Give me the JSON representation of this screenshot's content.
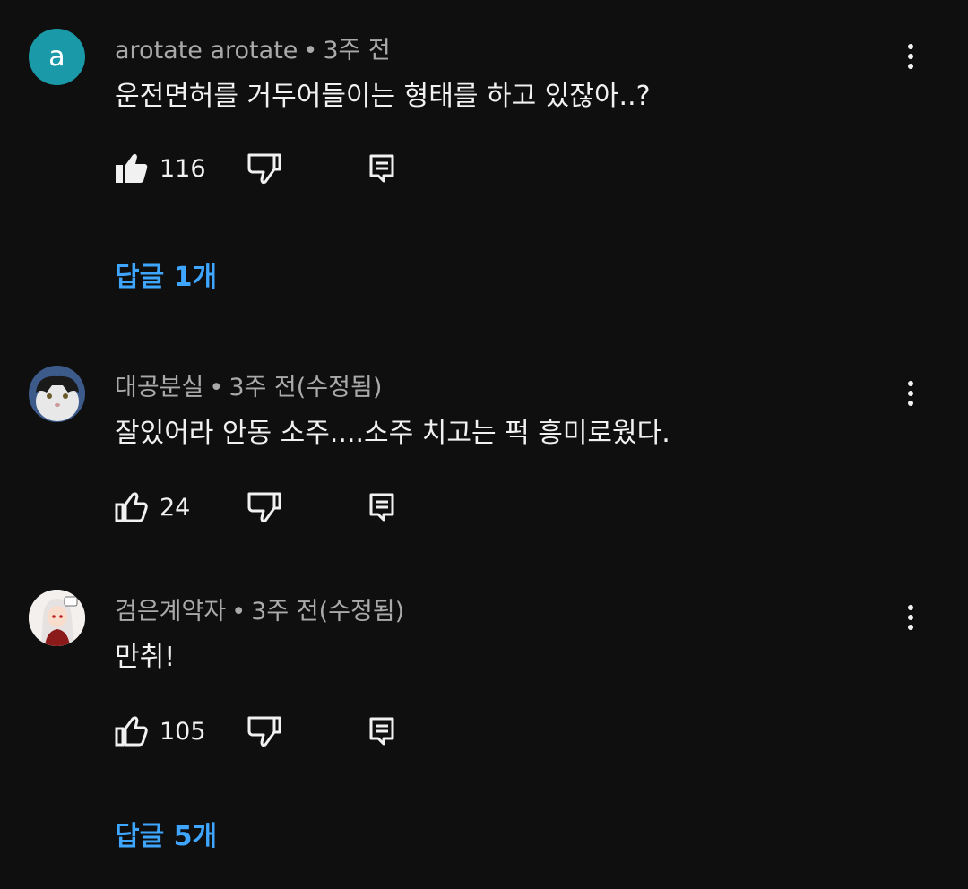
{
  "comments": [
    {
      "author": "arotate arotate",
      "time": "3주 전",
      "edited": "",
      "avatar_letter": "a",
      "avatar_color": "#1a9aa8",
      "text": "운전면허를 거두어들이는 형태를 하고 있잖아..?",
      "likes": "116",
      "liked": true,
      "replies_label": "답글 1개"
    },
    {
      "author": "대공분실",
      "time": "3주 전",
      "edited": "(수정됨)",
      "avatar_icon": "cat-avatar-icon",
      "text": "잘있어라 안동 소주....소주 치고는 퍽 흥미로웠다.",
      "likes": "24",
      "liked": false
    },
    {
      "author": "검은계약자",
      "time": "3주 전",
      "edited": "(수정됨)",
      "avatar_icon": "anime-girl-avatar-icon",
      "text": "만취!",
      "likes": "105",
      "liked": false,
      "replies_label": "답글 5개"
    }
  ],
  "separator": "•",
  "colors": {
    "background": "#0f0f0f",
    "link": "#3ea6ff",
    "meta": "#aaaaaa"
  }
}
